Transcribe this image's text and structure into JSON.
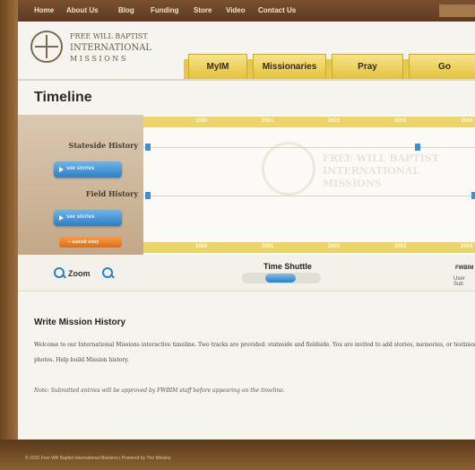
{
  "topnav": [
    "Home",
    "About Us",
    "Blog",
    "Funding",
    "Store",
    "Video",
    "Contact Us"
  ],
  "logo": {
    "line1": "FREE WILL BAPTIST",
    "line2": "INTERNATIONAL",
    "line3": "M I S S I O N S"
  },
  "tabs": [
    "MyIM",
    "Missionaries",
    "Pray",
    "Go"
  ],
  "page_title": "Timeline",
  "timeline": {
    "stateside_label": "Stateside History",
    "stateside_button": "see stories",
    "field_label": "Field History",
    "field_button": "see stories",
    "add_button": "+ submit entry",
    "years": [
      "2000",
      "2001",
      "2002",
      "2003",
      "2004"
    ],
    "watermark": "FREE WILL BAPTIST INTERNATIONAL MISSIONS"
  },
  "controls": {
    "zoom_label": "Zoom",
    "shuttle_label": "Time Shuttle",
    "right_title": "FWBIM",
    "right_sub": "User Sub"
  },
  "content": {
    "heading": "Write Mission History",
    "intro": "Welcome to our International Missions interactive timeline. Two tracks are provided: stateside and fieldside. You are invited to add stories, memories, or testimonies. Add photos. Help build Mission history.",
    "note": "Note: Submitted entries will be approved by FWBIM staff before appearing on the timeline."
  },
  "footer": "© 2010 Free Will Baptist International Missions | Powered by The Ministry"
}
